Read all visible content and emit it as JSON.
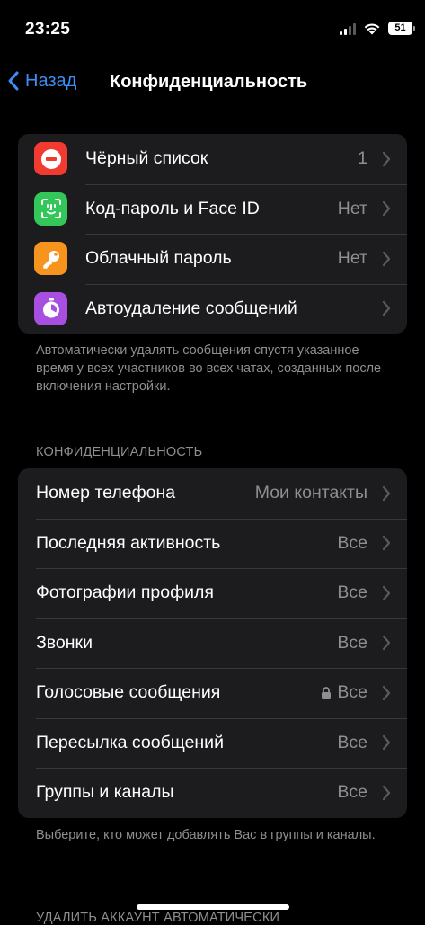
{
  "status_bar": {
    "time": "23:25",
    "battery": "51"
  },
  "nav": {
    "back_label": "Назад",
    "title": "Конфиденциальность"
  },
  "security_group": {
    "items": [
      {
        "label": "Чёрный список",
        "value": "1",
        "icon": "blocked-icon",
        "color": "#f23b30"
      },
      {
        "label": "Код-пароль и Face ID",
        "value": "Нет",
        "icon": "face-id-icon",
        "color": "#33c759"
      },
      {
        "label": "Облачный пароль",
        "value": "Нет",
        "icon": "key-icon",
        "color": "#f7941d"
      },
      {
        "label": "Автоудаление сообщений",
        "value": "",
        "icon": "timer-icon",
        "color": "#a64fe0"
      }
    ],
    "footer": "Автоматически удалять сообщения спустя указанное время у всех участников во всех чатах, созданных после включения настройки."
  },
  "privacy_group": {
    "header": "КОНФИДЕНЦИАЛЬНОСТЬ",
    "items": [
      {
        "label": "Номер телефона",
        "value": "Мои контакты"
      },
      {
        "label": "Последняя активность",
        "value": "Все"
      },
      {
        "label": "Фотографии профиля",
        "value": "Все"
      },
      {
        "label": "Звонки",
        "value": "Все"
      },
      {
        "label": "Голосовые сообщения",
        "value": "Все",
        "locked": true
      },
      {
        "label": "Пересылка сообщений",
        "value": "Все"
      },
      {
        "label": "Группы и каналы",
        "value": "Все"
      }
    ],
    "footer": "Выберите, кто может добавлять Вас в группы и каналы."
  },
  "next_section": {
    "header": "УДАЛИТЬ АККАУНТ АВТОМАТИЧЕСКИ"
  }
}
